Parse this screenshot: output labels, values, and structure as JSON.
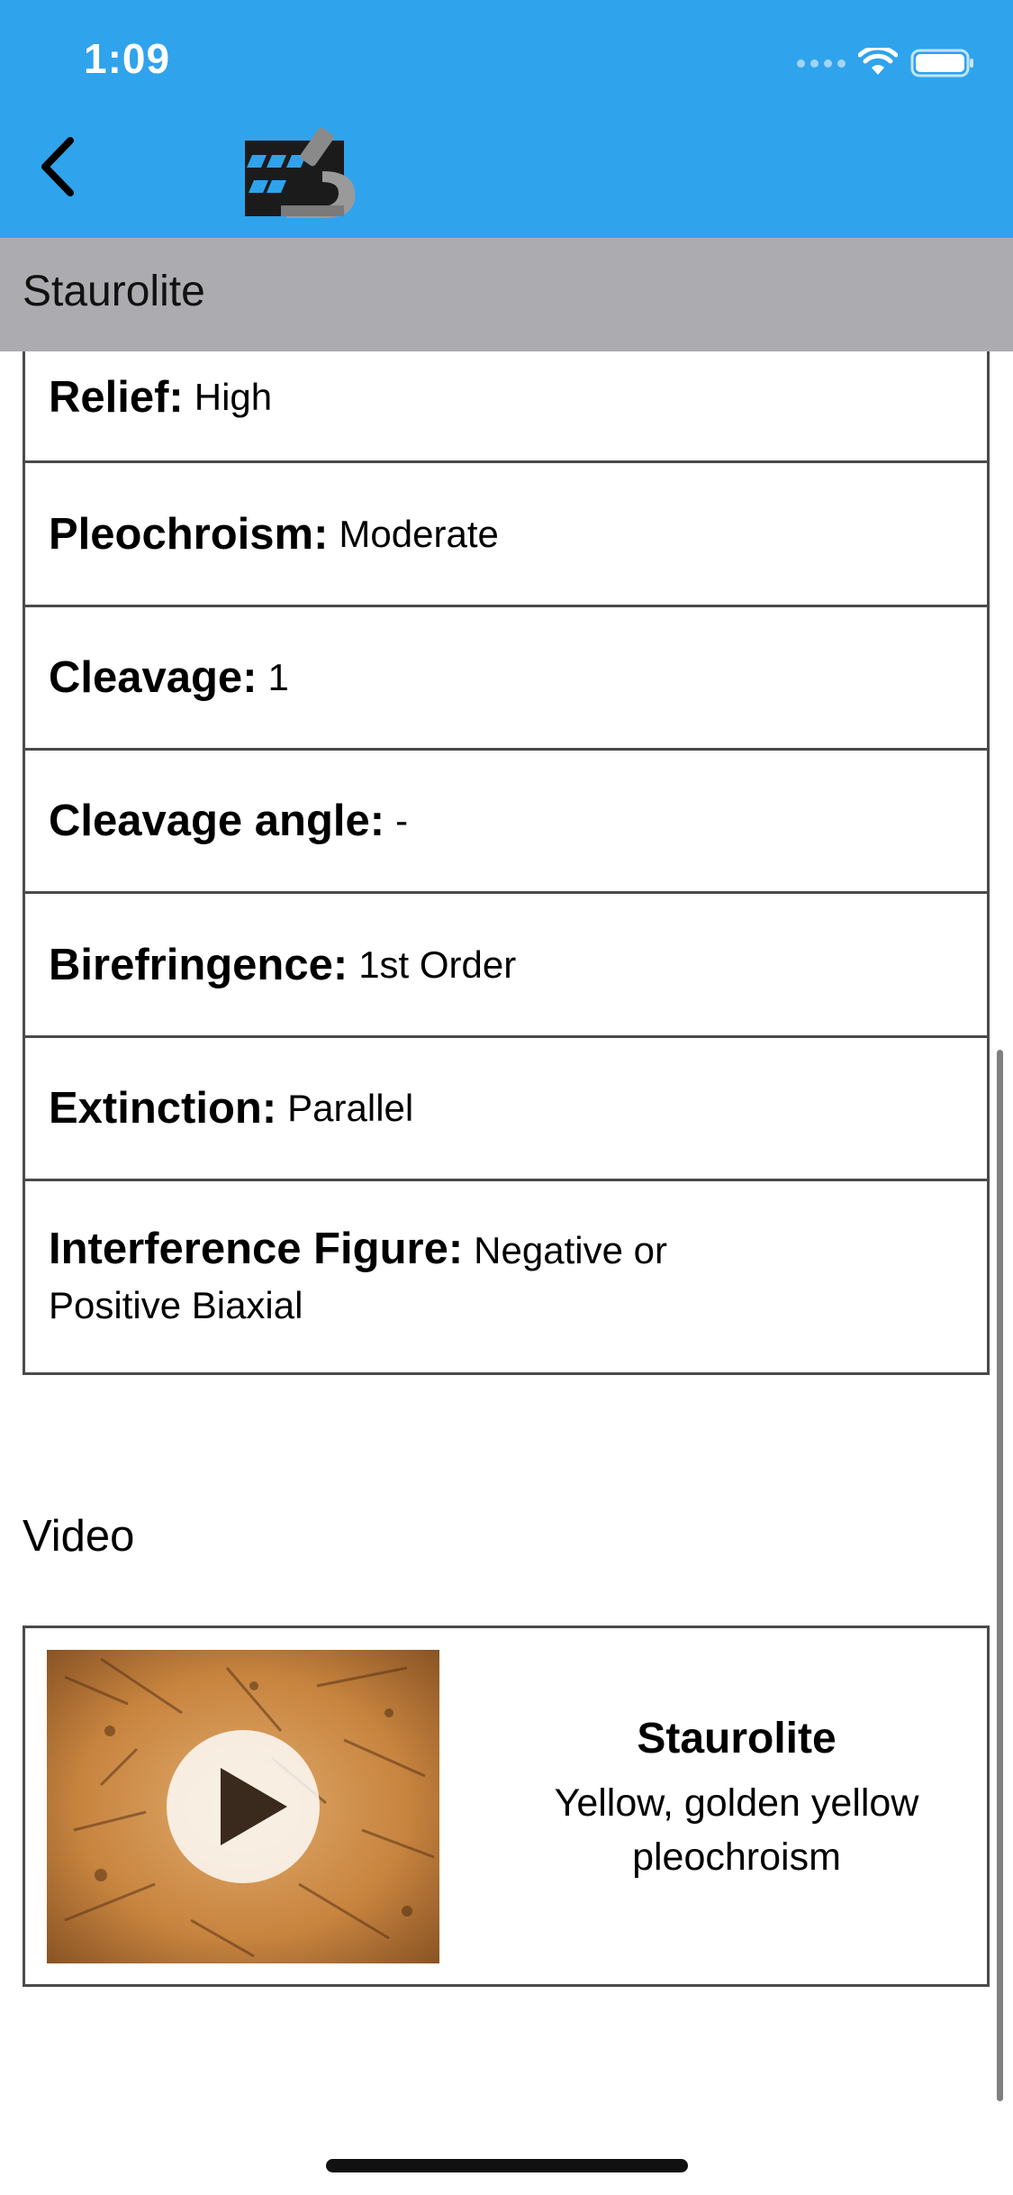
{
  "status_bar": {
    "time": "1:09",
    "icons": [
      "signal-dots-icon",
      "wifi-icon",
      "battery-icon"
    ]
  },
  "nav": {
    "back_icon": "chevron-left-icon",
    "logo_icon": "microscope-film-logo"
  },
  "header": {
    "title": "Staurolite"
  },
  "properties": [
    {
      "label": "Relief:",
      "value": "High"
    },
    {
      "label": "Pleochroism:",
      "value": "Moderate"
    },
    {
      "label": "Cleavage:",
      "value": "1"
    },
    {
      "label": "Cleavage angle:",
      "value": "-"
    },
    {
      "label": "Birefringence:",
      "value": "1st Order"
    },
    {
      "label": "Extinction:",
      "value": "Parallel"
    },
    {
      "label": "Interference Figure:",
      "value": "Negative or",
      "value_line2": "Positive  Biaxial"
    }
  ],
  "video_section": {
    "heading": "Video",
    "items": [
      {
        "title": "Staurolite",
        "description_line1": "Yellow, golden yellow",
        "description_line2": "pleochroism",
        "play_icon": "play-icon"
      }
    ]
  },
  "colors": {
    "header_blue": "#2fa3ec",
    "title_bar_gray": "#acacb0",
    "border": "#4a4a4a"
  }
}
